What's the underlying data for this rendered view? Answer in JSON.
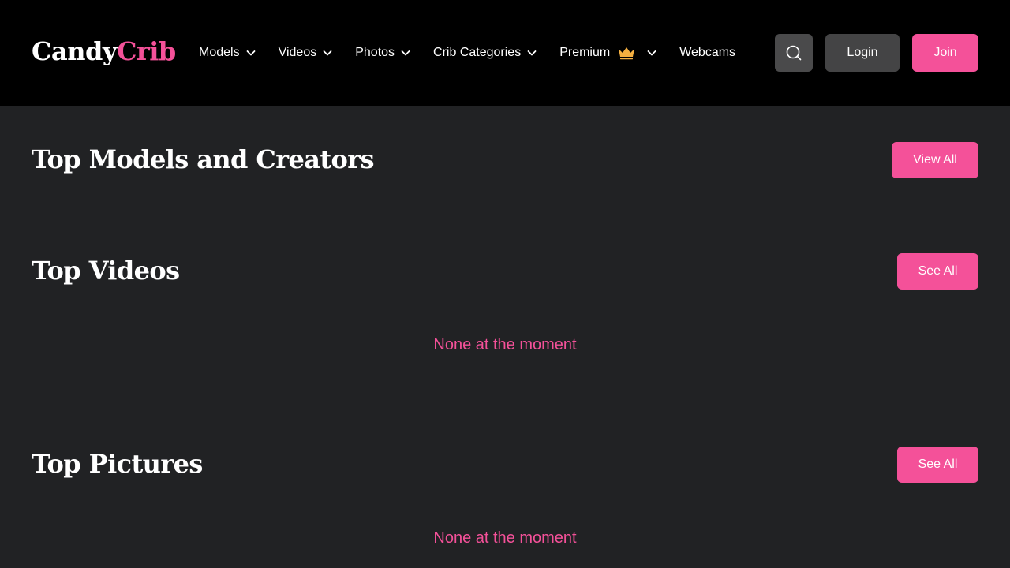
{
  "header": {
    "logo": {
      "part1": "Candy",
      "part2": "Crib"
    },
    "nav": [
      {
        "label": "Models"
      },
      {
        "label": "Videos"
      },
      {
        "label": "Photos"
      },
      {
        "label": "Crib Categories"
      },
      {
        "label": "Premium"
      },
      {
        "label": "Webcams"
      }
    ],
    "login_label": "Login",
    "join_label": "Join"
  },
  "sections": [
    {
      "title": "Top Models and Creators",
      "button_label": "View All"
    },
    {
      "title": "Top Videos",
      "button_label": "See All",
      "empty_message": "None at the moment"
    },
    {
      "title": "Top Pictures",
      "button_label": "See All",
      "empty_message": "None at the moment"
    }
  ],
  "icons": {
    "search": "search-icon",
    "chevron": "chevron-down-icon",
    "crown": "crown-icon"
  },
  "colors": {
    "accent": "#f45199",
    "header_bg": "#000000",
    "page_bg": "#212224",
    "crown": "#f5b041",
    "secondary_button": "#444445"
  }
}
